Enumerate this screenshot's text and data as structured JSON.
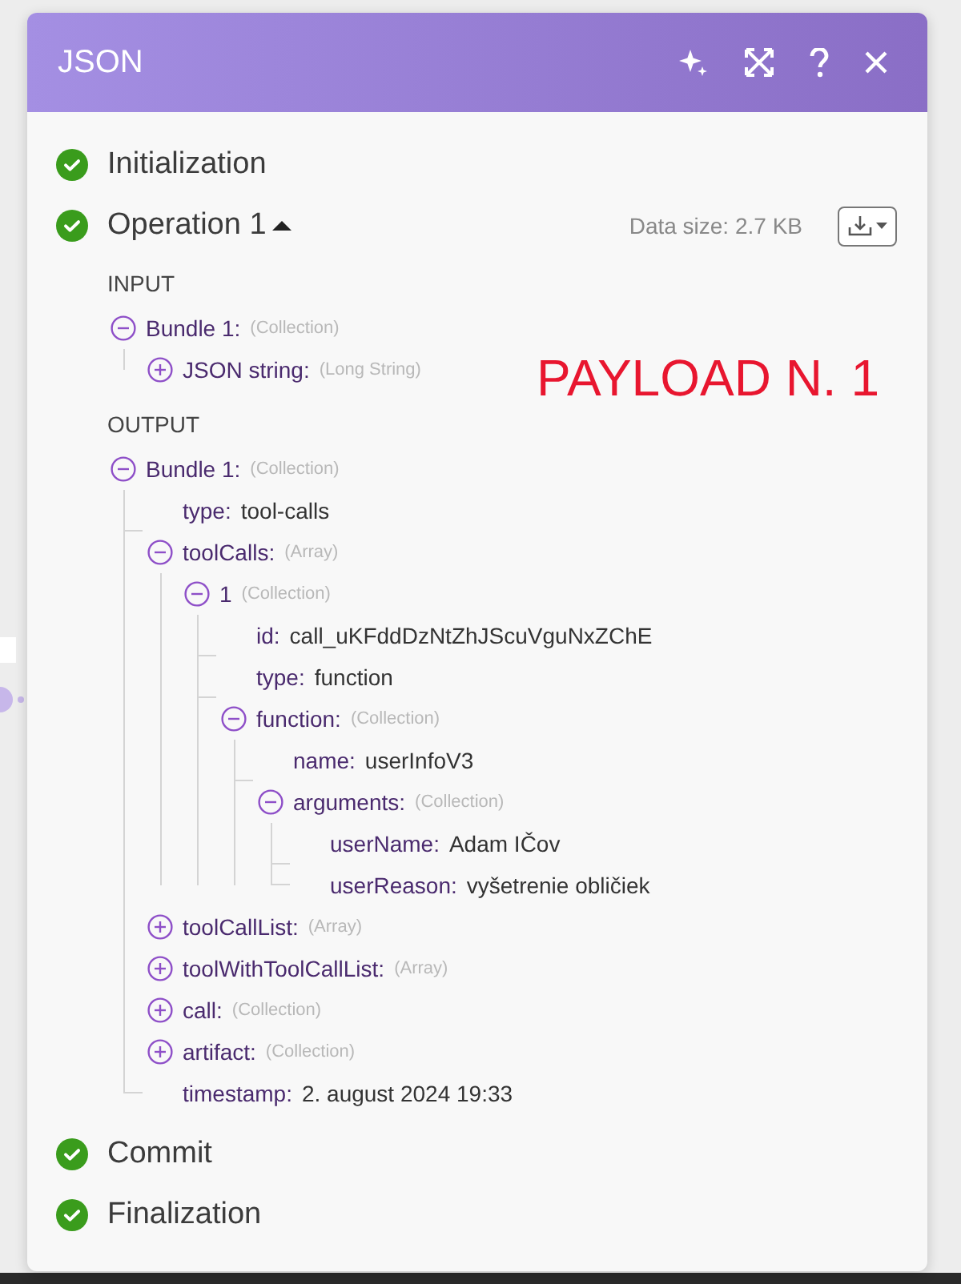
{
  "window": {
    "title": "JSON"
  },
  "stages": [
    {
      "name": "Initialization",
      "done": true
    },
    {
      "name": "Operation 1",
      "done": true,
      "expanded": true,
      "data_size": "Data size: 2.7 KB",
      "sections": [
        {
          "heading": "INPUT",
          "tree": [
            {
              "kind": "collection",
              "key": "Bundle 1:",
              "type": "(Collection)",
              "expanded": true,
              "children": [
                {
                  "kind": "collection",
                  "key": "JSON string:",
                  "type": "(Long String)",
                  "expanded": false
                }
              ]
            }
          ]
        },
        {
          "heading": "OUTPUT",
          "tree": [
            {
              "kind": "collection",
              "key": "Bundle 1:",
              "type": "(Collection)",
              "expanded": true,
              "children": [
                {
                  "kind": "value",
                  "key": "type:",
                  "value": "tool-calls"
                },
                {
                  "kind": "collection",
                  "key": "toolCalls:",
                  "type": "(Array)",
                  "expanded": true,
                  "children": [
                    {
                      "kind": "collection",
                      "key": "1",
                      "type": "(Collection)",
                      "expanded": true,
                      "children": [
                        {
                          "kind": "value",
                          "key": "id:",
                          "value": "call_uKFddDzNtZhJScuVguNxZChE"
                        },
                        {
                          "kind": "value",
                          "key": "type:",
                          "value": "function"
                        },
                        {
                          "kind": "collection",
                          "key": "function:",
                          "type": "(Collection)",
                          "expanded": true,
                          "children": [
                            {
                              "kind": "value",
                              "key": "name:",
                              "value": "userInfoV3"
                            },
                            {
                              "kind": "collection",
                              "key": "arguments:",
                              "type": "(Collection)",
                              "expanded": true,
                              "children": [
                                {
                                  "kind": "value",
                                  "key": "userName:",
                                  "value": "Adam IČov"
                                },
                                {
                                  "kind": "value",
                                  "key": "userReason:",
                                  "value": "vyšetrenie obličiek"
                                }
                              ]
                            }
                          ]
                        }
                      ]
                    }
                  ]
                },
                {
                  "kind": "collection",
                  "key": "toolCallList:",
                  "type": "(Array)",
                  "expanded": false
                },
                {
                  "kind": "collection",
                  "key": "toolWithToolCallList:",
                  "type": "(Array)",
                  "expanded": false
                },
                {
                  "kind": "collection",
                  "key": "call:",
                  "type": "(Collection)",
                  "expanded": false
                },
                {
                  "kind": "collection",
                  "key": "artifact:",
                  "type": "(Collection)",
                  "expanded": false
                },
                {
                  "kind": "value",
                  "key": "timestamp:",
                  "value": "2. august 2024 19:33"
                }
              ]
            }
          ]
        }
      ]
    },
    {
      "name": "Commit",
      "done": true
    },
    {
      "name": "Finalization",
      "done": true
    }
  ],
  "annotation": "PAYLOAD N. 1"
}
